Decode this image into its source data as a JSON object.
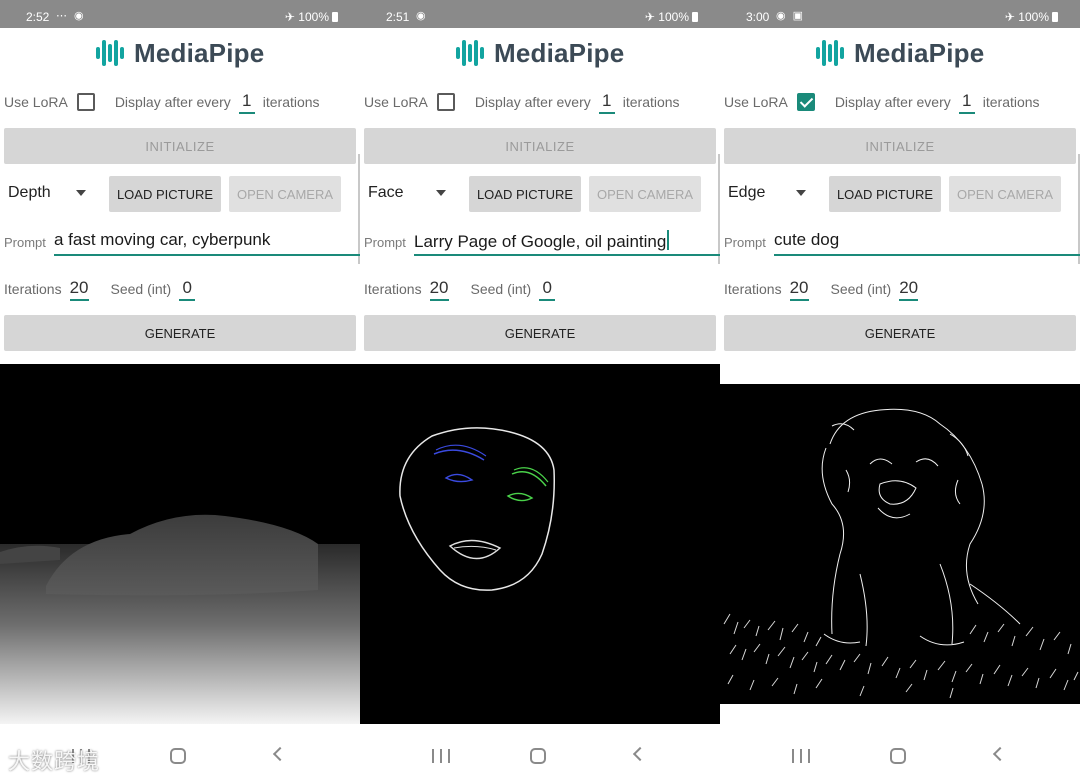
{
  "app": {
    "brand": "MediaPipe",
    "brand_color": "#12a4a0",
    "accent": "#1a8a7a"
  },
  "labels": {
    "use_lora": "Use LoRA",
    "display_after_every": "Display after every",
    "iterations_suffix": "iterations",
    "initialize": "INITIALIZE",
    "load_picture": "LOAD PICTURE",
    "open_camera": "OPEN CAMERA",
    "prompt": "Prompt",
    "iterations": "Iterations",
    "seed": "Seed (int)",
    "generate": "GENERATE"
  },
  "screens": [
    {
      "status": {
        "time": "2:52",
        "battery": "100%"
      },
      "use_lora_checked": false,
      "display_every": "1",
      "mode": "Depth",
      "prompt": "a fast moving car, cyberpunk",
      "iterations": "20",
      "seed": "0",
      "preview": "depth-map-car"
    },
    {
      "status": {
        "time": "2:51",
        "battery": "100%"
      },
      "use_lora_checked": false,
      "display_every": "1",
      "mode": "Face",
      "prompt": "Larry Page of Google, oil painting",
      "iterations": "20",
      "seed": "0",
      "preview": "face-landmarks"
    },
    {
      "status": {
        "time": "3:00",
        "battery": "100%"
      },
      "use_lora_checked": true,
      "display_every": "1",
      "mode": "Edge",
      "prompt": "cute dog",
      "iterations": "20",
      "seed": "20",
      "preview": "edge-map-dog"
    }
  ],
  "watermark": "大数跨境"
}
